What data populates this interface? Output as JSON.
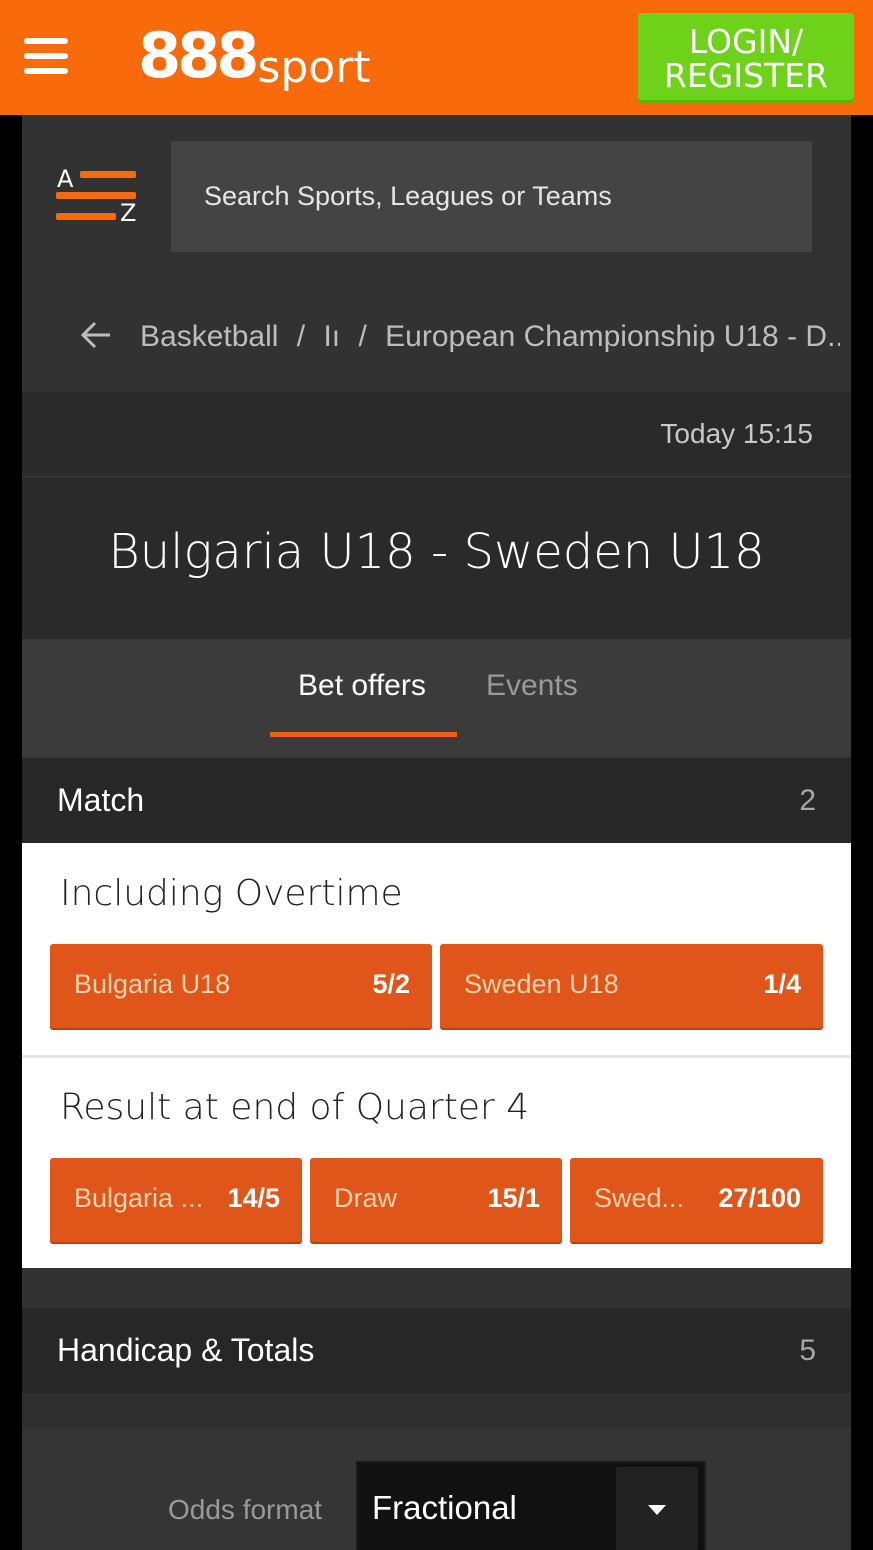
{
  "header": {
    "logo_num": "888",
    "logo_word": "sport",
    "login_line1": "LOGIN/",
    "login_line2": "REGISTER"
  },
  "search": {
    "az_top": "A",
    "az_bottom": "Z",
    "placeholder": "Search Sports, Leagues or Teams"
  },
  "breadcrumb": {
    "items": [
      "Basketball",
      "/",
      "Iı",
      "/",
      "European Championship U18 - D..."
    ]
  },
  "event": {
    "time": "Today 15:15",
    "title": "Bulgaria U18 - Sweden U18"
  },
  "tabs": [
    {
      "label": "Bet offers",
      "active": true
    },
    {
      "label": "Events",
      "active": false
    }
  ],
  "sections": {
    "match": {
      "label": "Match",
      "count": "2"
    },
    "handicap": {
      "label": "Handicap & Totals",
      "count": "5"
    }
  },
  "markets": [
    {
      "title": "Including Overtime",
      "outcomes": [
        {
          "name": "Bulgaria U18",
          "odds": "5/2"
        },
        {
          "name": "Sweden U18",
          "odds": "1/4"
        }
      ]
    },
    {
      "title": "Result at end of Quarter 4",
      "outcomes": [
        {
          "name": "Bulgaria ...",
          "odds": "14/5"
        },
        {
          "name": "Draw",
          "odds": "15/1"
        },
        {
          "name": "Swed...",
          "odds": "27/100"
        }
      ]
    }
  ],
  "odds_format": {
    "label": "Odds format",
    "value": "Fractional"
  },
  "colors": {
    "brand_orange": "#f96b0a",
    "login_green": "#6fd21a",
    "odds_button": "#e0561a"
  }
}
